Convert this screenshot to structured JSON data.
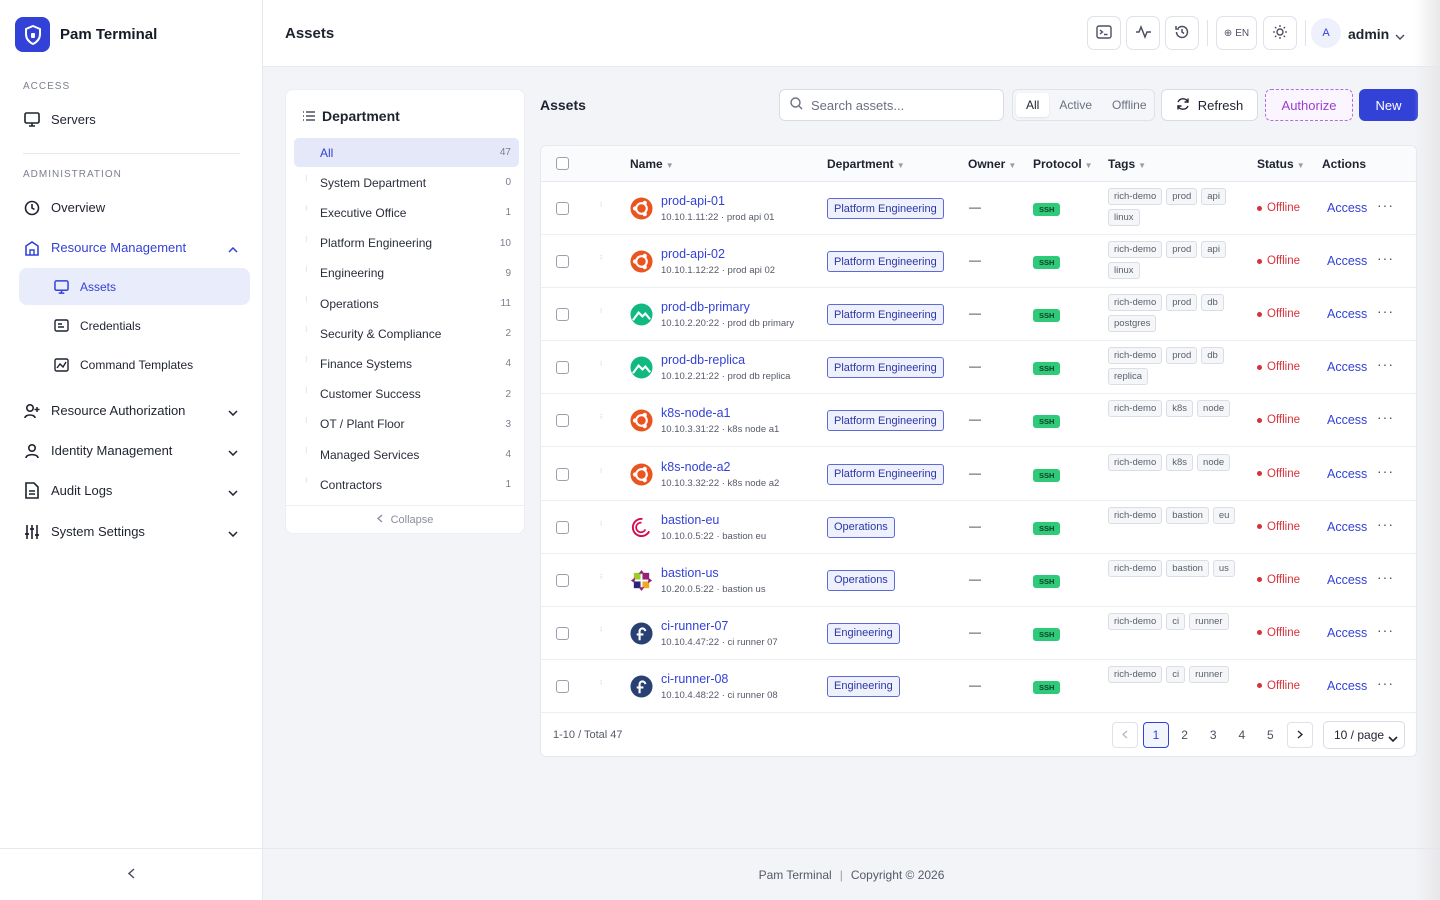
{
  "brand": {
    "name": "Pam Terminal"
  },
  "sidebar": {
    "access_label": "ACCESS",
    "admin_label": "ADMINISTRATION",
    "servers": "Servers",
    "overview": "Overview",
    "resource_management": "Resource Management",
    "assets": "Assets",
    "credentials": "Credentials",
    "command_templates": "Command Templates",
    "resource_authorization": "Resource Authorization",
    "identity_management": "Identity Management",
    "audit_logs": "Audit Logs",
    "system_settings": "System Settings"
  },
  "header": {
    "title": "Assets",
    "lang": "EN",
    "user_initial": "A",
    "user_name": "admin"
  },
  "department": {
    "title": "Department",
    "collapse": "Collapse",
    "items": [
      {
        "label": "All",
        "count": "47"
      },
      {
        "label": "System Department",
        "count": "0"
      },
      {
        "label": "Executive Office",
        "count": "1"
      },
      {
        "label": "Platform Engineering",
        "count": "10"
      },
      {
        "label": "Engineering",
        "count": "9"
      },
      {
        "label": "Operations",
        "count": "11"
      },
      {
        "label": "Security & Compliance",
        "count": "2"
      },
      {
        "label": "Finance Systems",
        "count": "4"
      },
      {
        "label": "Customer Success",
        "count": "2"
      },
      {
        "label": "OT / Plant Floor",
        "count": "3"
      },
      {
        "label": "Managed Services",
        "count": "4"
      },
      {
        "label": "Contractors",
        "count": "1"
      }
    ]
  },
  "assets": {
    "title": "Assets",
    "search_placeholder": "Search assets...",
    "filters": [
      "All",
      "Active",
      "Offline"
    ],
    "refresh": "Refresh",
    "authorize": "Authorize",
    "new": "New",
    "columns": {
      "name": "Name",
      "department": "Department",
      "owner": "Owner",
      "protocol": "Protocol",
      "tags": "Tags",
      "status": "Status",
      "actions": "Actions"
    },
    "rows": [
      {
        "name": "prod-api-01",
        "sub": "10.10.1.11:22 · prod api 01",
        "os": "ubuntu",
        "department": "Platform Engineering",
        "owner": "—",
        "protocol": "SSH",
        "tags": [
          "rich-demo",
          "prod",
          "api",
          "linux"
        ],
        "status": "Offline",
        "action": "Access"
      },
      {
        "name": "prod-api-02",
        "sub": "10.10.1.12:22 · prod api 02",
        "os": "ubuntu",
        "department": "Platform Engineering",
        "owner": "—",
        "protocol": "SSH",
        "tags": [
          "rich-demo",
          "prod",
          "api",
          "linux"
        ],
        "status": "Offline",
        "action": "Access"
      },
      {
        "name": "prod-db-primary",
        "sub": "10.10.2.20:22 · prod db primary",
        "os": "rocky",
        "department": "Platform Engineering",
        "owner": "—",
        "protocol": "SSH",
        "tags": [
          "rich-demo",
          "prod",
          "db",
          "postgres"
        ],
        "status": "Offline",
        "action": "Access"
      },
      {
        "name": "prod-db-replica",
        "sub": "10.10.2.21:22 · prod db replica",
        "os": "rocky",
        "department": "Platform Engineering",
        "owner": "—",
        "protocol": "SSH",
        "tags": [
          "rich-demo",
          "prod",
          "db",
          "replica"
        ],
        "status": "Offline",
        "action": "Access"
      },
      {
        "name": "k8s-node-a1",
        "sub": "10.10.3.31:22 · k8s node a1",
        "os": "ubuntu",
        "department": "Platform Engineering",
        "owner": "—",
        "protocol": "SSH",
        "tags": [
          "rich-demo",
          "k8s",
          "node"
        ],
        "status": "Offline",
        "action": "Access"
      },
      {
        "name": "k8s-node-a2",
        "sub": "10.10.3.32:22 · k8s node a2",
        "os": "ubuntu",
        "department": "Platform Engineering",
        "owner": "—",
        "protocol": "SSH",
        "tags": [
          "rich-demo",
          "k8s",
          "node"
        ],
        "status": "Offline",
        "action": "Access"
      },
      {
        "name": "bastion-eu",
        "sub": "10.10.0.5:22 · bastion eu",
        "os": "debian",
        "department": "Operations",
        "owner": "—",
        "protocol": "SSH",
        "tags": [
          "rich-demo",
          "bastion",
          "eu"
        ],
        "status": "Offline",
        "action": "Access"
      },
      {
        "name": "bastion-us",
        "sub": "10.20.0.5:22 · bastion us",
        "os": "centos",
        "department": "Operations",
        "owner": "—",
        "protocol": "SSH",
        "tags": [
          "rich-demo",
          "bastion",
          "us"
        ],
        "status": "Offline",
        "action": "Access"
      },
      {
        "name": "ci-runner-07",
        "sub": "10.10.4.47:22 · ci runner 07",
        "os": "fedora",
        "department": "Engineering",
        "owner": "—",
        "protocol": "SSH",
        "tags": [
          "rich-demo",
          "ci",
          "runner"
        ],
        "status": "Offline",
        "action": "Access"
      },
      {
        "name": "ci-runner-08",
        "sub": "10.10.4.48:22 · ci runner 08",
        "os": "fedora",
        "department": "Engineering",
        "owner": "—",
        "protocol": "SSH",
        "tags": [
          "rich-demo",
          "ci",
          "runner"
        ],
        "status": "Offline",
        "action": "Access"
      }
    ],
    "total_text": "1-10 / Total 47",
    "pages": [
      "1",
      "2",
      "3",
      "4",
      "5"
    ],
    "current_page": "1",
    "page_size": "10 / page"
  },
  "footer": {
    "brand": "Pam Terminal",
    "copyright": "Copyright © 2026"
  },
  "colors": {
    "accent": "#3342d6",
    "offline": "#d9303a",
    "ssh": "#2fc97a",
    "authorize": "#9a3fcf"
  }
}
